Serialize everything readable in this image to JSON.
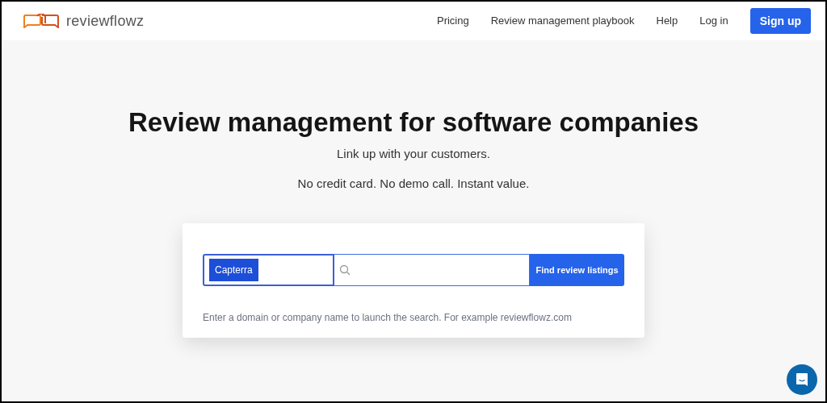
{
  "header": {
    "logo_text": "reviewflowz",
    "nav": [
      {
        "label": "Pricing",
        "kind": "link"
      },
      {
        "label": "Review management playbook",
        "kind": "link"
      },
      {
        "label": "Help",
        "kind": "link"
      },
      {
        "label": "Log in",
        "kind": "link"
      },
      {
        "label": "Sign up",
        "kind": "button"
      }
    ]
  },
  "hero": {
    "title": "Review management for software companies",
    "subtitle": "Link up with your customers.",
    "tagline": "No credit card. No demo call. Instant value."
  },
  "search_card": {
    "platform_select": {
      "value": "Capterra"
    },
    "submit_button": "Find review listings",
    "hint": "Enter a domain or company name to launch the search. For example reviewflowz.com"
  }
}
